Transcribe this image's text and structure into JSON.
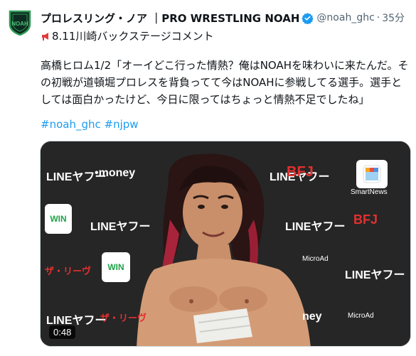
{
  "account": {
    "display_name": "プロレスリング・ノア ｜PRO WRESTLING NOAH",
    "handle": "@noah_ghc",
    "separator": "·",
    "time": "35分",
    "avatar_text": "NOAH",
    "verified_color": "#1d9bf0"
  },
  "tweet": {
    "headline": "8.11川崎バックステージコメント",
    "body": "高橋ヒロム1/2「オーイどこ行った情熱？俺はNOAHを味わいに来たんだ。その初戦が道頓堀プロレスを背負ってて今はNOAHに参戦してる選手。選手としては面白かったけど、今日に限ってはちょっと情熱不足でしたね」",
    "hashtags": [
      "#noah_ghc",
      "#njpw"
    ],
    "link_color": "#1d9bf0"
  },
  "media": {
    "duration": "0:48",
    "backdrop": {
      "lineyahoo": "LINEヤフー",
      "money": "•money",
      "smartnews": "SmartNews",
      "microad": "MicroAd",
      "winticket": "WINTICKET",
      "win": "WIN",
      "zalea": "ザ・リーヴ",
      "ney": "ney"
    }
  }
}
